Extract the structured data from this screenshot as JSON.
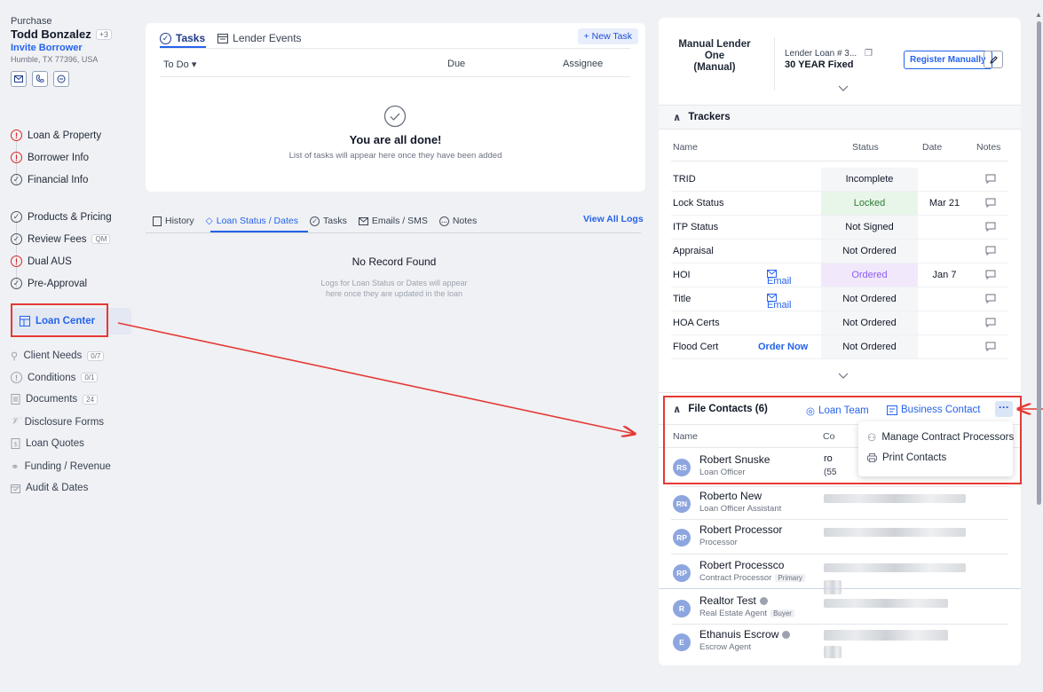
{
  "sidebar": {
    "purchase_label": "Purchase",
    "borrower_name": "Todd Bonzalez",
    "borrower_extra": "+3",
    "invite_label": "Invite Borrower",
    "address": "Humble, TX 77396, USA",
    "contact_icons": [
      "mail-icon",
      "phone-icon",
      "chat-icon"
    ],
    "items": [
      {
        "label": "Loan & Property",
        "status": "error"
      },
      {
        "label": "Borrower Info",
        "status": "error"
      },
      {
        "label": "Financial Info",
        "status": "complete"
      },
      {
        "label": "Products & Pricing",
        "status": "complete"
      },
      {
        "label": "Review Fees",
        "status": "complete",
        "badge": "QM"
      },
      {
        "label": "Dual AUS",
        "status": "error"
      },
      {
        "label": "Pre-Approval",
        "status": "complete"
      }
    ],
    "loan_center_label": "Loan Center",
    "tools": [
      {
        "label": "Client Needs",
        "badge": "0/7",
        "icon": "client-needs-icon"
      },
      {
        "label": "Conditions",
        "badge": "0/1",
        "icon": "conditions-icon"
      },
      {
        "label": "Documents",
        "badge": "24",
        "icon": "documents-icon"
      },
      {
        "label": "Disclosure Forms",
        "icon": "signature-icon"
      },
      {
        "label": "Loan Quotes",
        "icon": "quote-icon"
      },
      {
        "label": "Funding / Revenue",
        "icon": "funding-icon"
      },
      {
        "label": "Audit & Dates",
        "icon": "calendar-icon"
      }
    ]
  },
  "tasks": {
    "tabs": [
      "Tasks",
      "Lender Events"
    ],
    "new_task_label": "+ New Task",
    "col_todo": "To Do",
    "col_due": "Due",
    "col_assignee": "Assignee",
    "empty_title": "You are all done!",
    "empty_sub": "List of tasks will appear here once they have been added"
  },
  "logs": {
    "tabs": [
      "History",
      "Loan Status / Dates",
      "Tasks",
      "Emails / SMS",
      "Notes"
    ],
    "view_all": "View All Logs",
    "empty_title": "No Record Found",
    "empty_sub_1": "Logs for Loan Status or Dates will appear",
    "empty_sub_2": "here once they are updated in the loan"
  },
  "lender": {
    "name_1": "Manual Lender",
    "name_2": "One",
    "name_3": "(Manual)",
    "loan_number": "Lender Loan # 3...",
    "program": "30 YEAR Fixed",
    "register_label": "Register Manually"
  },
  "trackers": {
    "title": "Trackers",
    "headers": {
      "name": "Name",
      "status": "Status",
      "date": "Date",
      "notes": "Notes"
    },
    "email_label": "Email",
    "order_now_label": "Order Now",
    "rows": [
      {
        "name": "TRID",
        "status": "Incomplete",
        "date": ""
      },
      {
        "name": "Lock Status",
        "status": "Locked",
        "date": "Mar 21"
      },
      {
        "name": "ITP Status",
        "status": "Not Signed",
        "date": ""
      },
      {
        "name": "Appraisal",
        "status": "Not Ordered",
        "date": ""
      },
      {
        "name": "HOI",
        "status": "Ordered",
        "date": "Jan 7",
        "action": "Email"
      },
      {
        "name": "Title",
        "status": "Not Ordered",
        "date": "",
        "action": "Email"
      },
      {
        "name": "HOA Certs",
        "status": "Not Ordered",
        "date": ""
      },
      {
        "name": "Flood Cert",
        "status": "Not Ordered",
        "date": "",
        "action": "Order Now"
      }
    ]
  },
  "file_contacts": {
    "title": "File Contacts (6)",
    "loan_team_label": "Loan Team",
    "business_contact_label": "Business Contact",
    "more_label": "···",
    "header_name": "Name",
    "header_contact": "Co",
    "first_contact_partial_1": "ro",
    "first_contact_partial_2": "(55",
    "contacts": [
      {
        "initials": "RS",
        "name": "Robert Snuske",
        "role": "Loan Officer"
      },
      {
        "initials": "RN",
        "name": "Roberto New",
        "role": "Loan Officer Assistant"
      },
      {
        "initials": "RP",
        "name": "Robert Processor",
        "role": "Processor"
      },
      {
        "initials": "RP",
        "name": "Robert Processco",
        "role": "Contract Processor",
        "tag": "Primary"
      },
      {
        "initials": "R",
        "name": "Realtor Test",
        "role": "Real Estate Agent",
        "tag": "Buyer",
        "info": true
      },
      {
        "initials": "E",
        "name": "Ethanuis Escrow",
        "role": "Escrow Agent",
        "info": true
      }
    ],
    "menu": [
      "Manage Contract Processors",
      "Print Contacts"
    ]
  },
  "colors": {
    "accent": "#2563eb",
    "highlight": "#e53935",
    "error": "#dc2626"
  }
}
